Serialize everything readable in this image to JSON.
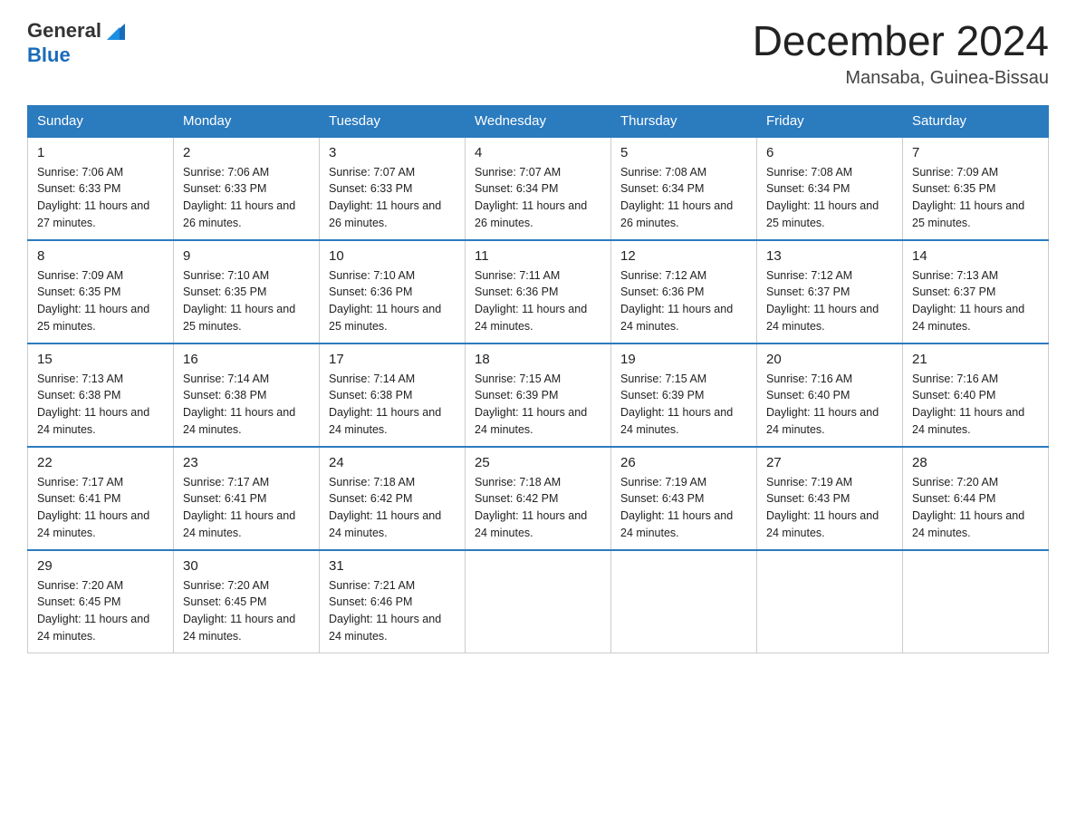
{
  "header": {
    "logo_general": "General",
    "logo_blue": "Blue",
    "month_title": "December 2024",
    "location": "Mansaba, Guinea-Bissau"
  },
  "days_of_week": [
    "Sunday",
    "Monday",
    "Tuesday",
    "Wednesday",
    "Thursday",
    "Friday",
    "Saturday"
  ],
  "weeks": [
    [
      {
        "day": "1",
        "sunrise": "7:06 AM",
        "sunset": "6:33 PM",
        "daylight": "11 hours and 27 minutes."
      },
      {
        "day": "2",
        "sunrise": "7:06 AM",
        "sunset": "6:33 PM",
        "daylight": "11 hours and 26 minutes."
      },
      {
        "day": "3",
        "sunrise": "7:07 AM",
        "sunset": "6:33 PM",
        "daylight": "11 hours and 26 minutes."
      },
      {
        "day": "4",
        "sunrise": "7:07 AM",
        "sunset": "6:34 PM",
        "daylight": "11 hours and 26 minutes."
      },
      {
        "day": "5",
        "sunrise": "7:08 AM",
        "sunset": "6:34 PM",
        "daylight": "11 hours and 26 minutes."
      },
      {
        "day": "6",
        "sunrise": "7:08 AM",
        "sunset": "6:34 PM",
        "daylight": "11 hours and 25 minutes."
      },
      {
        "day": "7",
        "sunrise": "7:09 AM",
        "sunset": "6:35 PM",
        "daylight": "11 hours and 25 minutes."
      }
    ],
    [
      {
        "day": "8",
        "sunrise": "7:09 AM",
        "sunset": "6:35 PM",
        "daylight": "11 hours and 25 minutes."
      },
      {
        "day": "9",
        "sunrise": "7:10 AM",
        "sunset": "6:35 PM",
        "daylight": "11 hours and 25 minutes."
      },
      {
        "day": "10",
        "sunrise": "7:10 AM",
        "sunset": "6:36 PM",
        "daylight": "11 hours and 25 minutes."
      },
      {
        "day": "11",
        "sunrise": "7:11 AM",
        "sunset": "6:36 PM",
        "daylight": "11 hours and 24 minutes."
      },
      {
        "day": "12",
        "sunrise": "7:12 AM",
        "sunset": "6:36 PM",
        "daylight": "11 hours and 24 minutes."
      },
      {
        "day": "13",
        "sunrise": "7:12 AM",
        "sunset": "6:37 PM",
        "daylight": "11 hours and 24 minutes."
      },
      {
        "day": "14",
        "sunrise": "7:13 AM",
        "sunset": "6:37 PM",
        "daylight": "11 hours and 24 minutes."
      }
    ],
    [
      {
        "day": "15",
        "sunrise": "7:13 AM",
        "sunset": "6:38 PM",
        "daylight": "11 hours and 24 minutes."
      },
      {
        "day": "16",
        "sunrise": "7:14 AM",
        "sunset": "6:38 PM",
        "daylight": "11 hours and 24 minutes."
      },
      {
        "day": "17",
        "sunrise": "7:14 AM",
        "sunset": "6:38 PM",
        "daylight": "11 hours and 24 minutes."
      },
      {
        "day": "18",
        "sunrise": "7:15 AM",
        "sunset": "6:39 PM",
        "daylight": "11 hours and 24 minutes."
      },
      {
        "day": "19",
        "sunrise": "7:15 AM",
        "sunset": "6:39 PM",
        "daylight": "11 hours and 24 minutes."
      },
      {
        "day": "20",
        "sunrise": "7:16 AM",
        "sunset": "6:40 PM",
        "daylight": "11 hours and 24 minutes."
      },
      {
        "day": "21",
        "sunrise": "7:16 AM",
        "sunset": "6:40 PM",
        "daylight": "11 hours and 24 minutes."
      }
    ],
    [
      {
        "day": "22",
        "sunrise": "7:17 AM",
        "sunset": "6:41 PM",
        "daylight": "11 hours and 24 minutes."
      },
      {
        "day": "23",
        "sunrise": "7:17 AM",
        "sunset": "6:41 PM",
        "daylight": "11 hours and 24 minutes."
      },
      {
        "day": "24",
        "sunrise": "7:18 AM",
        "sunset": "6:42 PM",
        "daylight": "11 hours and 24 minutes."
      },
      {
        "day": "25",
        "sunrise": "7:18 AM",
        "sunset": "6:42 PM",
        "daylight": "11 hours and 24 minutes."
      },
      {
        "day": "26",
        "sunrise": "7:19 AM",
        "sunset": "6:43 PM",
        "daylight": "11 hours and 24 minutes."
      },
      {
        "day": "27",
        "sunrise": "7:19 AM",
        "sunset": "6:43 PM",
        "daylight": "11 hours and 24 minutes."
      },
      {
        "day": "28",
        "sunrise": "7:20 AM",
        "sunset": "6:44 PM",
        "daylight": "11 hours and 24 minutes."
      }
    ],
    [
      {
        "day": "29",
        "sunrise": "7:20 AM",
        "sunset": "6:45 PM",
        "daylight": "11 hours and 24 minutes."
      },
      {
        "day": "30",
        "sunrise": "7:20 AM",
        "sunset": "6:45 PM",
        "daylight": "11 hours and 24 minutes."
      },
      {
        "day": "31",
        "sunrise": "7:21 AM",
        "sunset": "6:46 PM",
        "daylight": "11 hours and 24 minutes."
      },
      null,
      null,
      null,
      null
    ]
  ]
}
